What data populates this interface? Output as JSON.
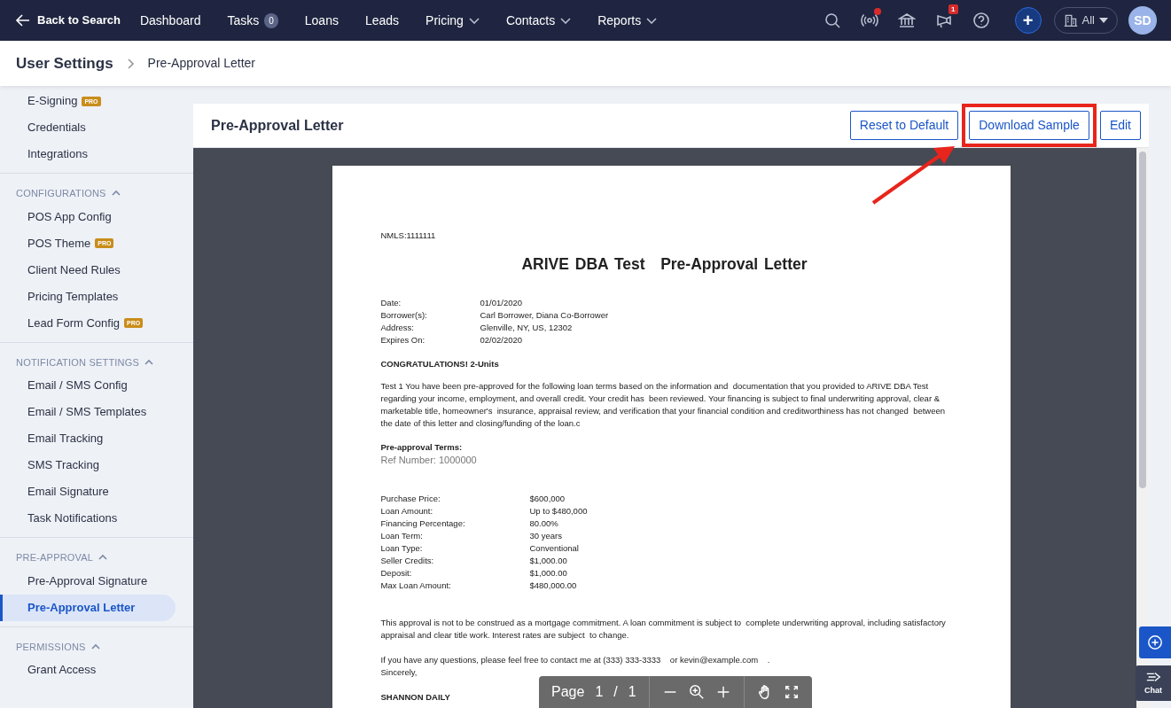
{
  "nav": {
    "back": "Back to Search",
    "items": [
      {
        "label": "Dashboard",
        "dropdown": false
      },
      {
        "label": "Tasks",
        "badge": "0",
        "dropdown": false
      },
      {
        "label": "Loans",
        "dropdown": false
      },
      {
        "label": "Leads",
        "dropdown": false
      },
      {
        "label": "Pricing",
        "dropdown": true
      },
      {
        "label": "Contacts",
        "dropdown": true
      },
      {
        "label": "Reports",
        "dropdown": true
      }
    ],
    "notification_dot": true,
    "announcement_badge": "1",
    "add": "+",
    "scope": "All",
    "avatar": "SD"
  },
  "breadcrumb": [
    "User Settings",
    "Pre-Approval Letter"
  ],
  "sidebar": [
    {
      "kind": "plain",
      "items": [
        {
          "label": "E-Signing",
          "badge": "PRO",
          "selected": false
        },
        {
          "label": "Credentials",
          "selected": false
        },
        {
          "label": "Integrations",
          "selected": false
        }
      ]
    },
    {
      "kind": "section",
      "title": "CONFIGURATIONS",
      "expanded": true,
      "items": [
        {
          "label": "POS App Config",
          "selected": false
        },
        {
          "label": "POS Theme",
          "badge": "PRO",
          "selected": false
        },
        {
          "label": "Client Need Rules",
          "selected": false
        },
        {
          "label": "Pricing Templates",
          "selected": false
        },
        {
          "label": "Lead Form Config",
          "badge": "PRO",
          "selected": false
        }
      ]
    },
    {
      "kind": "section",
      "title": "NOTIFICATION SETTINGS",
      "expanded": true,
      "items": [
        {
          "label": "Email / SMS Config",
          "selected": false
        },
        {
          "label": "Email / SMS Templates",
          "selected": false
        },
        {
          "label": "Email Tracking",
          "selected": false
        },
        {
          "label": "SMS Tracking",
          "selected": false
        },
        {
          "label": "Email Signature",
          "selected": false
        },
        {
          "label": "Task Notifications",
          "selected": false
        }
      ]
    },
    {
      "kind": "section",
      "title": "PRE-APPROVAL",
      "expanded": true,
      "items": [
        {
          "label": "Pre-Approval Signature",
          "selected": false
        },
        {
          "label": "Pre-Approval Letter",
          "selected": true
        }
      ]
    },
    {
      "kind": "section",
      "title": "PERMISSIONS",
      "expanded": true,
      "items": [
        {
          "label": "Grant Access",
          "selected": false
        }
      ]
    }
  ],
  "panel": {
    "title": "Pre-Approval Letter",
    "buttons": [
      {
        "label": "Reset to Default",
        "highlighted": false
      },
      {
        "label": "Download Sample",
        "highlighted": true
      },
      {
        "label": "Edit",
        "highlighted": false
      }
    ]
  },
  "letter": {
    "nmls": "NMLS:1111111",
    "title_parts": [
      "ARIVE DBA Test",
      "Pre-Approval Letter"
    ],
    "details": [
      [
        "Date:",
        "01/01/2020"
      ],
      [
        "Borrower(s):",
        "Carl Borrower, Diana Co-Borrower"
      ],
      [
        "Address:",
        "Glenville, NY, US, 12302"
      ],
      [
        "Expires On:",
        "02/02/2020"
      ]
    ],
    "congrats": "CONGRATULATIONS! 2-Units",
    "intro": "Test 1 You have been pre-approved for the following loan terms based on the information and  documentation that you provided to ARIVE DBA Test    regarding your income, employment, and overall credit. Your credit has  been reviewed. Your financing is subject to final underwriting approval, clear & marketable title, homeowner's  insurance, appraisal review, and verification that your financial condition and creditworthiness has not changed  between the date of this letter and closing/funding of the loan.c",
    "terms_heading": "Pre-approval Terms:",
    "ref": "Ref Number: 1000000",
    "terms": [
      [
        "Purchase Price:",
        "$600,000"
      ],
      [
        "Loan Amount:",
        "Up to $480,000"
      ],
      [
        "Financing Percentage:",
        "80.00%"
      ],
      [
        "Loan Term:",
        "30 years"
      ],
      [
        "Loan Type:",
        "Conventional"
      ],
      [
        "Seller Credits:",
        "$1,000.00"
      ],
      [
        "Deposit:",
        "$1,000.00"
      ],
      [
        "Max Loan Amount:",
        "$480,000.00"
      ]
    ],
    "disclaimer": "This approval is not to be construed as a mortgage commitment. A loan commitment is subject to  complete underwriting approval, including satisfactory appraisal and clear title work. Interest rates are subject  to change.",
    "contact": "If you have any questions, please feel free to contact me at (333) 333-3333    or kevin@example.com    .",
    "closing": "Sincerely,",
    "signer": "SHANNON DAILY"
  },
  "viewer": {
    "page_label": "Page",
    "page": "1",
    "separator": "/",
    "pages": "1"
  },
  "chat": "Chat"
}
